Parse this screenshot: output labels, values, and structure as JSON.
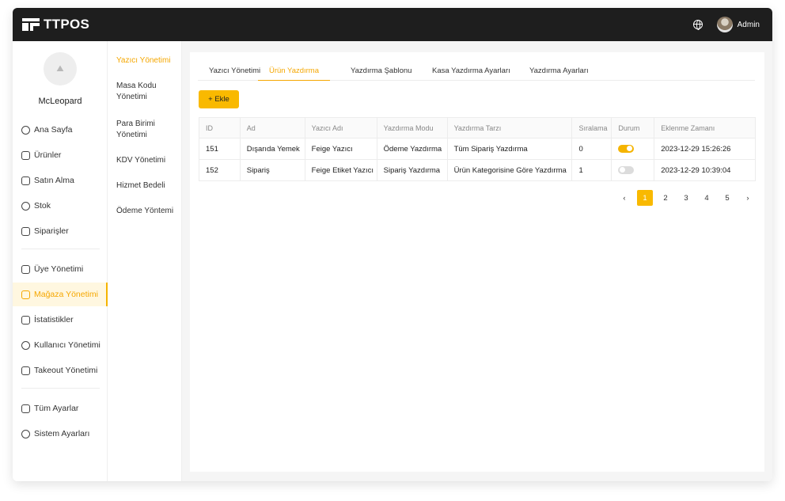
{
  "app": {
    "logo_text": "TTPOS"
  },
  "topbar": {
    "globe_icon": "globe-icon",
    "user_label": "Admin"
  },
  "sidebar": {
    "user_name": "McLeopard",
    "groups": [
      [
        {
          "label": "Ana Sayfa",
          "icon": "home-icon"
        },
        {
          "label": "Ürünler",
          "icon": "product-icon"
        },
        {
          "label": "Satın Alma",
          "icon": "cart-icon"
        },
        {
          "label": "Stok",
          "icon": "stock-icon"
        },
        {
          "label": "Siparişler",
          "icon": "orders-icon"
        }
      ],
      [
        {
          "label": "Üye Yönetimi",
          "icon": "member-icon"
        },
        {
          "label": "Mağaza Yönetimi",
          "icon": "store-icon",
          "active": true
        },
        {
          "label": "İstatistikler",
          "icon": "stats-icon"
        },
        {
          "label": "Kullanıcı Yönetimi",
          "icon": "users-icon"
        },
        {
          "label": "Takeout Yönetimi",
          "icon": "takeout-icon"
        }
      ],
      [
        {
          "label": "Tüm Ayarlar",
          "icon": "settings-grid-icon"
        },
        {
          "label": "Sistem Ayarları",
          "icon": "gear-icon"
        }
      ]
    ]
  },
  "subnav": {
    "items": [
      {
        "label": "Yazıcı Yönetimi",
        "active": true
      },
      {
        "label": "Masa Kodu Yönetimi"
      },
      {
        "label": "Para Birimi Yönetimi"
      },
      {
        "label": "KDV Yönetimi"
      },
      {
        "label": "Hizmet Bedeli"
      },
      {
        "label": "Ödeme Yöntemi"
      }
    ]
  },
  "main": {
    "tabs": [
      {
        "label": "Yazıcı Yönetimi"
      },
      {
        "label": "Ürün Yazdırma",
        "active": true
      },
      {
        "label": "Yazdırma Şablonu"
      },
      {
        "label": "Kasa Yazdırma Ayarları"
      },
      {
        "label": "Yazdırma Ayarları"
      }
    ],
    "add_button": "+ Ekle",
    "table": {
      "columns": [
        "ID",
        "Ad",
        "Yazıcı Adı",
        "Yazdırma Modu",
        "Yazdırma Tarzı",
        "Sıralama",
        "Durum",
        "Eklenme Zamanı"
      ],
      "rows": [
        {
          "id": "151",
          "name": "Dışarıda Yemek",
          "printer": "Feige Yazıcı",
          "mode": "Ödeme Yazdırma",
          "style": "Tüm Sipariş Yazdırma",
          "order": "0",
          "status": true,
          "time": "2023-12-29 15:26:26"
        },
        {
          "id": "152",
          "name": "Sipariş",
          "printer": "Feige Etiket Yazıcı",
          "mode": "Sipariş Yazdırma",
          "style": "Ürün Kategorisine Göre Yazdırma",
          "order": "1",
          "status": false,
          "time": "2023-12-29 10:39:04"
        }
      ]
    },
    "pagination": {
      "prev": "‹",
      "pages": [
        "1",
        "2",
        "3",
        "4",
        "5"
      ],
      "current": "1",
      "next": "›"
    }
  },
  "colors": {
    "accent": "#f9b900",
    "topbar": "#1e1e1e"
  }
}
